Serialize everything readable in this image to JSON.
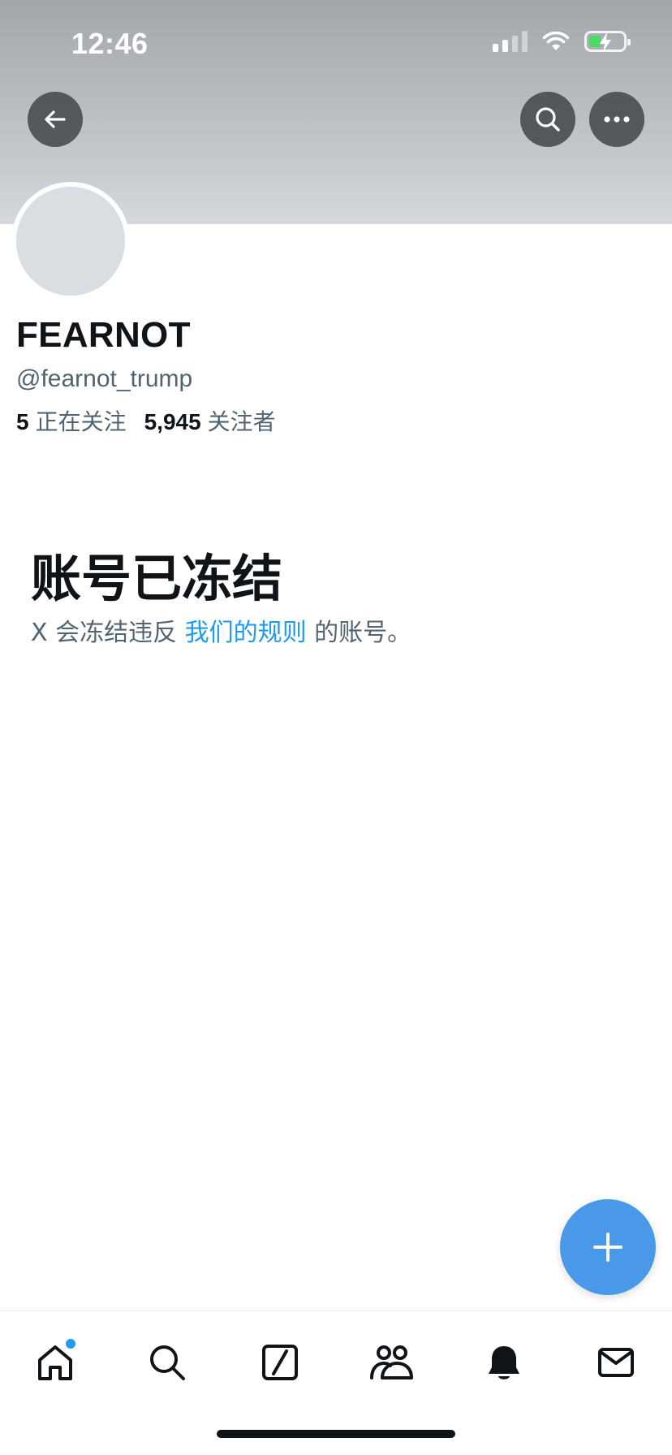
{
  "status_bar": {
    "time": "12:46",
    "icons": [
      "cellular-signal-icon",
      "wifi-icon",
      "battery-charging-icon"
    ]
  },
  "header": {
    "back_icon": "arrow-left-icon",
    "search_icon": "search-icon",
    "more_icon": "more-horizontal-icon"
  },
  "profile": {
    "display_name": "FEARNOT",
    "handle": "@fearnot_trump",
    "following_count": "5",
    "following_label": "正在关注",
    "followers_count": "5,945",
    "followers_label": "关注者"
  },
  "suspended": {
    "title": "账号已冻结",
    "text_before": "X 会冻结违反 ",
    "link_text": "我们的规则",
    "text_after": " 的账号。"
  },
  "fab": {
    "icon": "plus-icon"
  },
  "bottom_nav": {
    "items": [
      "home-icon",
      "search-icon",
      "grok-icon",
      "communities-icon",
      "notifications-icon",
      "messages-icon"
    ],
    "active": "home-icon"
  },
  "colors": {
    "accent": "#1d9bf0",
    "fab": "#4a99e9",
    "text_primary": "#0f1419",
    "text_secondary": "#536471",
    "banner": "#bcc1c6"
  }
}
